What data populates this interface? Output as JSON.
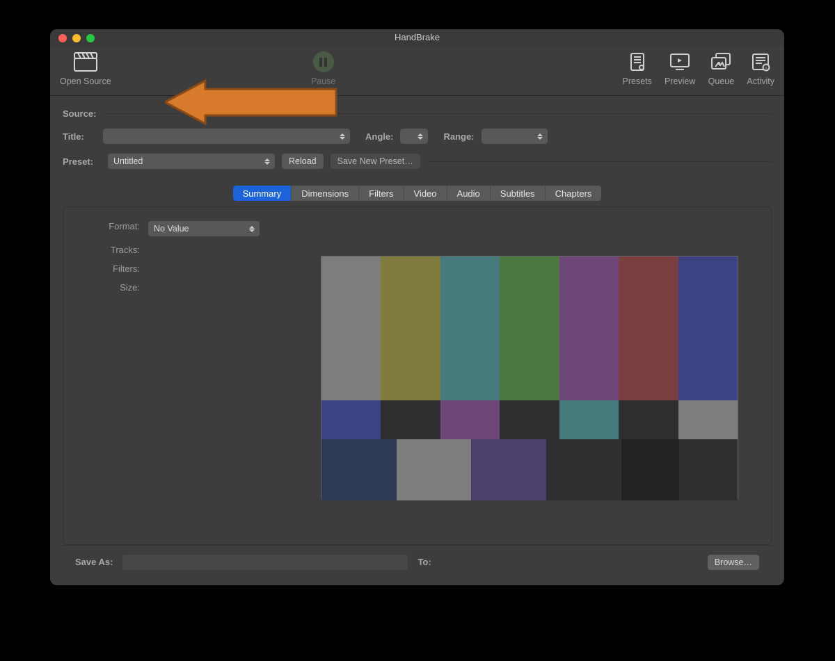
{
  "window": {
    "title": "HandBrake"
  },
  "toolbar": {
    "open_source": "Open Source",
    "pause": "Pause",
    "presets": "Presets",
    "preview": "Preview",
    "queue": "Queue",
    "activity": "Activity"
  },
  "labels": {
    "source": "Source:",
    "title": "Title:",
    "angle": "Angle:",
    "range": "Range:",
    "preset": "Preset:",
    "format": "Format:",
    "tracks": "Tracks:",
    "filters": "Filters:",
    "size": "Size:",
    "save_as": "Save As:",
    "to": "To:"
  },
  "values": {
    "title_select": "",
    "angle_select": "",
    "range_select": "",
    "preset_select": "Untitled",
    "format_select": "No Value",
    "save_as": ""
  },
  "buttons": {
    "reload": "Reload",
    "save_new_preset": "Save New Preset…",
    "browse": "Browse…"
  },
  "tabs": [
    "Summary",
    "Dimensions",
    "Filters",
    "Video",
    "Audio",
    "Subtitles",
    "Chapters"
  ],
  "active_tab": "Summary",
  "smpte_colors": {
    "top": [
      "#7d7d7d",
      "#7f7c3d",
      "#467a7c",
      "#4c783f",
      "#6d4778",
      "#7b3f3f",
      "#3c4284"
    ],
    "mid": [
      "#3c4284",
      "#2f2f2f",
      "#6d4778",
      "#2f2f2f",
      "#467a7c",
      "#2f2f2f",
      "#7d7d7d"
    ],
    "bot": [
      "#2e3a54",
      "#7d7d7d",
      "#4c3f6d",
      "#2f2f2f",
      "#222222",
      "#2f2f2f"
    ]
  },
  "annotation": {
    "arrow_color": "#d87a2b"
  }
}
